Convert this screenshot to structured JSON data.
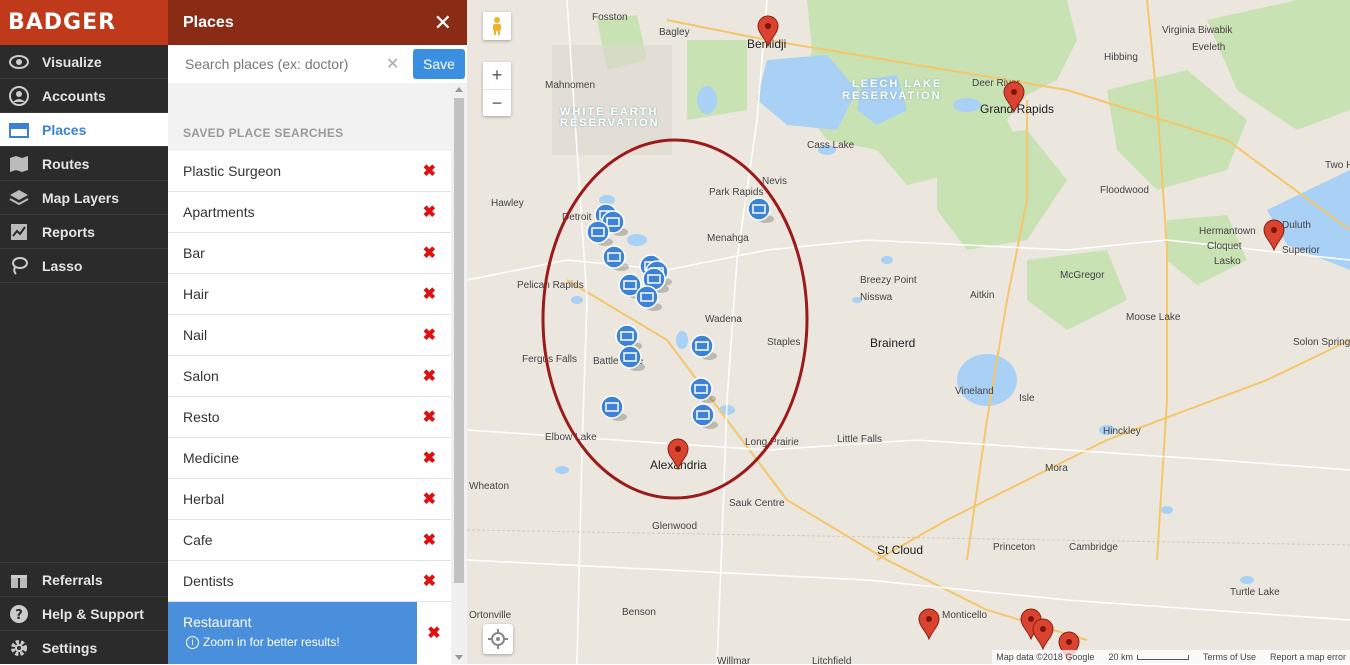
{
  "brand": "BADGER",
  "nav": {
    "items": [
      {
        "label": "Visualize",
        "icon": "eye-icon"
      },
      {
        "label": "Accounts",
        "icon": "user-icon"
      },
      {
        "label": "Places",
        "icon": "store-icon"
      },
      {
        "label": "Routes",
        "icon": "map-icon"
      },
      {
        "label": "Map Layers",
        "icon": "layers-icon"
      },
      {
        "label": "Reports",
        "icon": "chart-icon"
      },
      {
        "label": "Lasso",
        "icon": "lasso-icon"
      }
    ],
    "bottom": [
      {
        "label": "Referrals",
        "icon": "gift-icon"
      },
      {
        "label": "Help & Support",
        "icon": "help-icon"
      },
      {
        "label": "Settings",
        "icon": "gear-icon"
      }
    ]
  },
  "panel": {
    "title": "Places",
    "close": "✕",
    "search_placeholder": "Search places (ex: doctor)",
    "clear": "✕",
    "save": "Save",
    "saved_label": "SAVED PLACE SEARCHES",
    "searches": [
      "Plastic Surgeon",
      "Apartments",
      "Bar",
      "Hair",
      "Nail",
      "Salon",
      "Resto",
      "Medicine",
      "Herbal",
      "Cafe",
      "Dentists"
    ],
    "delete_glyph": "✖",
    "active_search": "Restaurant",
    "active_note": "Zoom in for better results!",
    "info_glyph": "i"
  },
  "map": {
    "zoom_in": "+",
    "zoom_out": "−",
    "labels": [
      "Fosston",
      "Bagley",
      "Bemidji",
      "Virginia Biwabik",
      "Eveleth",
      "Hibbing",
      "Mahnomen",
      "LEECH LAKE",
      "RESERVATION",
      "Deer River",
      "Grand Rapids",
      "WHITE EARTH",
      "RESERVATION",
      "Cass Lake",
      "Nevis",
      "Park Rapids",
      "Floodwood",
      "Two H",
      "Hawley",
      "Detroit",
      "Menahga",
      "Hermantown",
      "Cloquet",
      "Duluth",
      "Lasko",
      "Superior",
      "Pelican Rapids",
      "Breezy Point",
      "Nisswa",
      "Aitkin",
      "McGregor",
      "Moose Lake",
      "Wadena",
      "Brainerd",
      "Staples",
      "Solon Springs",
      "Fergus Falls",
      "Battle Lake",
      "Vineland",
      "Isle",
      "Hinckley",
      "Elbow Lake",
      "Long Prairie",
      "Little Falls",
      "Mora",
      "Alexandria",
      "Wheaton",
      "Sauk Centre",
      "Glenwood",
      "St Cloud",
      "Princeton",
      "Cambridge",
      "Turtle Lake",
      "Ortonville",
      "Benson",
      "Monticello",
      "Willmar",
      "Litchfield"
    ],
    "attribution": {
      "data": "Map data ©2018 Google",
      "scale": "20 km",
      "terms": "Terms of Use",
      "report": "Report a map error"
    },
    "colors": {
      "lasso": "#9b1b1b",
      "marker_red": "#d9432f",
      "marker_blue": "#3d82d4",
      "park_green": "#c9e2b4",
      "water": "#a9d0f5"
    }
  }
}
